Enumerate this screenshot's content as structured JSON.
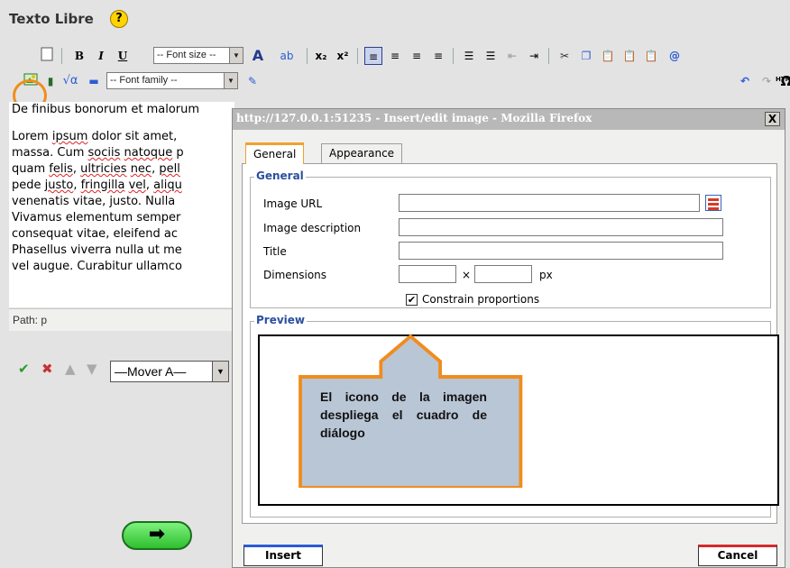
{
  "header": {
    "title": "Texto Libre",
    "help_symbol": "?"
  },
  "toolbar": {
    "font_size_label": "-- Font size --",
    "font_family_label": "-- Font family --",
    "bold": "B",
    "italic": "I",
    "underline": "U",
    "omega": "Ω",
    "html": "HTML"
  },
  "editor": {
    "first_line": "De finibus bonorum et malorum",
    "lines": [
      [
        "Lorem ",
        "ipsum",
        " dolor sit amet,"
      ],
      [
        "massa. Cum ",
        "sociis",
        " ",
        "natoque",
        " p"
      ],
      [
        "quam ",
        "felis",
        ", ",
        "ultricies",
        " ",
        "nec",
        ", ",
        "pell"
      ],
      [
        "pede ",
        "justo",
        ", ",
        "fringilla",
        " ",
        "vel",
        ", ",
        "aliqu"
      ],
      [
        "venenatis",
        " ",
        "vitae",
        ", ",
        "justo",
        ". Nulla"
      ],
      [
        "Vivamus",
        " ",
        "elementum",
        " ",
        "semper"
      ],
      [
        "consequat",
        " ",
        "vitae",
        ", ",
        "eleifend",
        " ",
        "ac"
      ],
      [
        "Phasellus",
        " ",
        "viverra",
        " ",
        "nulla",
        " ",
        "ut",
        " me"
      ],
      [
        "vel",
        " ",
        "augue",
        ". ",
        "Curabitur",
        " ",
        "ullamco"
      ]
    ]
  },
  "pathbar": {
    "text": "Path: p"
  },
  "controls": {
    "mover_select": "—Mover A—",
    "next_arrow": "➡"
  },
  "dialog": {
    "title": "http://127.0.0.1:51235 - Insert/edit image - Mozilla Firefox",
    "close": "X",
    "tabs": [
      "General",
      "Appearance"
    ],
    "general_legend": "General",
    "fields": {
      "image_url": {
        "label": "Image URL",
        "value": ""
      },
      "image_description": {
        "label": "Image description",
        "value": ""
      },
      "title": {
        "label": "Title",
        "value": ""
      },
      "dimensions": {
        "label": "Dimensions",
        "width": "",
        "height": "",
        "separator": "×",
        "unit": "px"
      }
    },
    "constrain_label": "Constrain proportions",
    "constrain_checked": true,
    "preview_legend": "Preview",
    "insert_label": "Insert",
    "cancel_label": "Cancel"
  },
  "callout": {
    "text": "El icono de la imagen despliega el cuadro de diálogo"
  },
  "colors": {
    "accent_orange": "#f08c1d",
    "legend_blue": "#2b4f9e",
    "callout_fill": "#b9c6d6"
  }
}
